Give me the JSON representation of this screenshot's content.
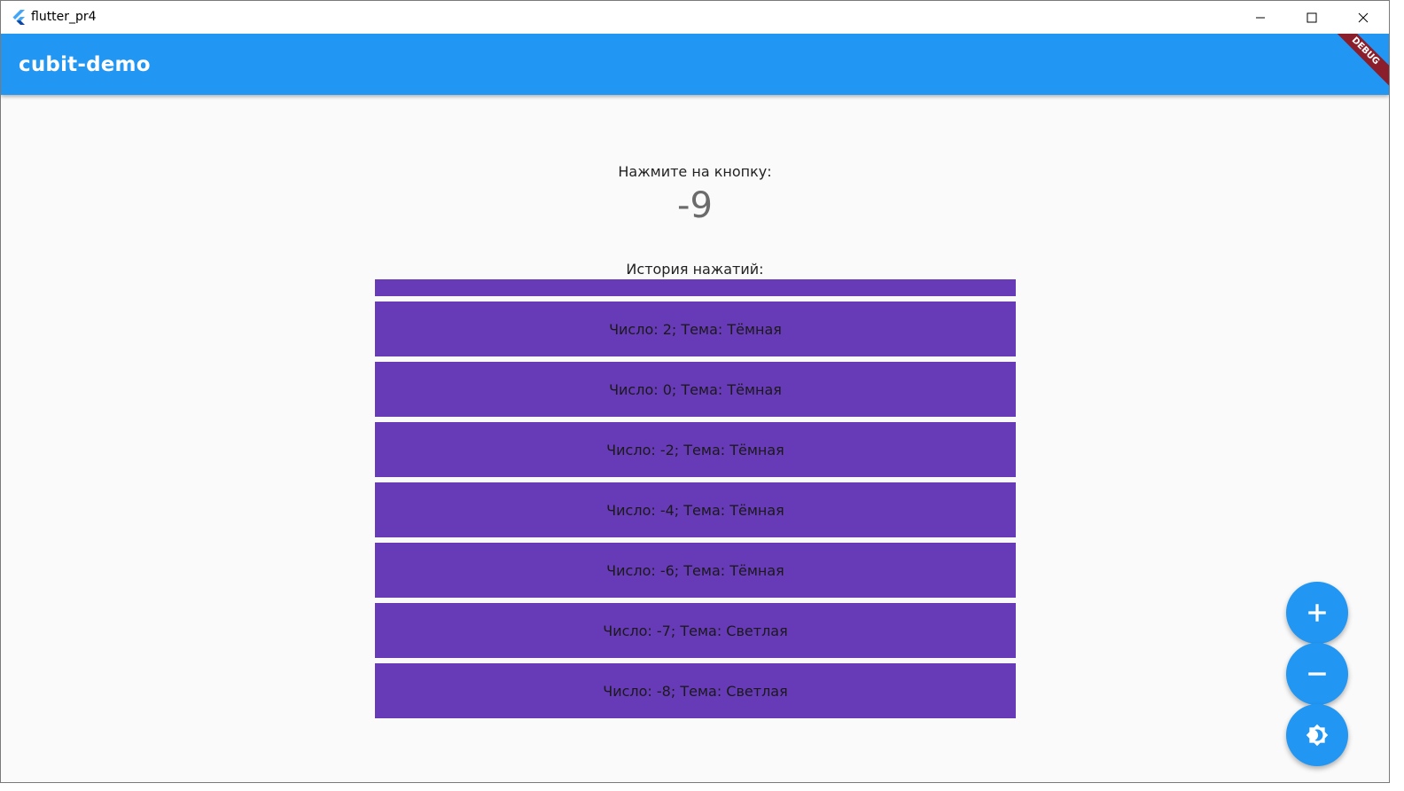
{
  "window": {
    "title": "flutter_pr4"
  },
  "appbar": {
    "title": "cubit-demo",
    "debug_label": "DEBUG"
  },
  "main": {
    "prompt": "Нажмите на кнопку:",
    "counter": "-9",
    "history_label": "История нажатий:",
    "history": [
      "Число: 2; Тема: Тёмная",
      "Число: 0; Тема: Тёмная",
      "Число: -2; Тема: Тёмная",
      "Число: -4; Тема: Тёмная",
      "Число: -6; Тема: Тёмная",
      "Число: -7; Тема: Светлая",
      "Число: -8; Тема: Светлая"
    ]
  },
  "fabs": [
    {
      "name": "increment-button",
      "icon": "plus-icon"
    },
    {
      "name": "decrement-button",
      "icon": "minus-icon"
    },
    {
      "name": "theme-toggle-button",
      "icon": "brightness-icon"
    }
  ],
  "colors": {
    "primary": "#2196f3",
    "history_item": "#673ab7",
    "background": "#fafafa",
    "debug_banner": "#8a1f2b"
  }
}
